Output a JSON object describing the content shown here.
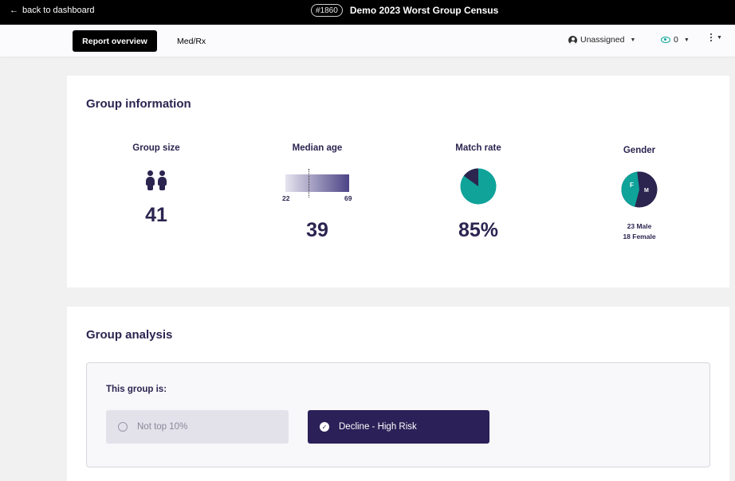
{
  "topbar": {
    "back_label": "back to dashboard",
    "report_id": "#1860",
    "report_title": "Demo 2023 Worst Group Census"
  },
  "subbar": {
    "tabs": [
      {
        "label": "Report overview",
        "active": true
      },
      {
        "label": "Med/Rx",
        "active": false
      }
    ],
    "assignee": "Unassigned",
    "watchers_count": "0",
    "icons": {
      "assignee": "user-icon",
      "watchers": "eye-icon",
      "menu": "kebab-icon"
    }
  },
  "group_information": {
    "title": "Group information",
    "group_size": {
      "label": "Group size",
      "value": "41",
      "icon": "people-icon"
    },
    "median_age": {
      "label": "Median age",
      "value": "39",
      "min": "22",
      "max": "69",
      "median_fraction": 0.36
    },
    "match_rate": {
      "label": "Match rate",
      "value": "85%",
      "fraction": 0.85
    },
    "gender": {
      "label": "Gender",
      "female_letter": "F",
      "male_letter": "M",
      "male_count_text": "23 Male",
      "female_count_text": "18 Female",
      "male": 23,
      "female": 18
    }
  },
  "group_analysis": {
    "title": "Group analysis",
    "heading": "This group is:",
    "options": [
      {
        "label": "Not top 10%",
        "selected": false
      },
      {
        "label": "Decline - High Risk",
        "selected": true
      }
    ]
  },
  "colors": {
    "navy": "#2b2550",
    "teal": "#0fa39a",
    "selected_bg": "#2b2057"
  }
}
